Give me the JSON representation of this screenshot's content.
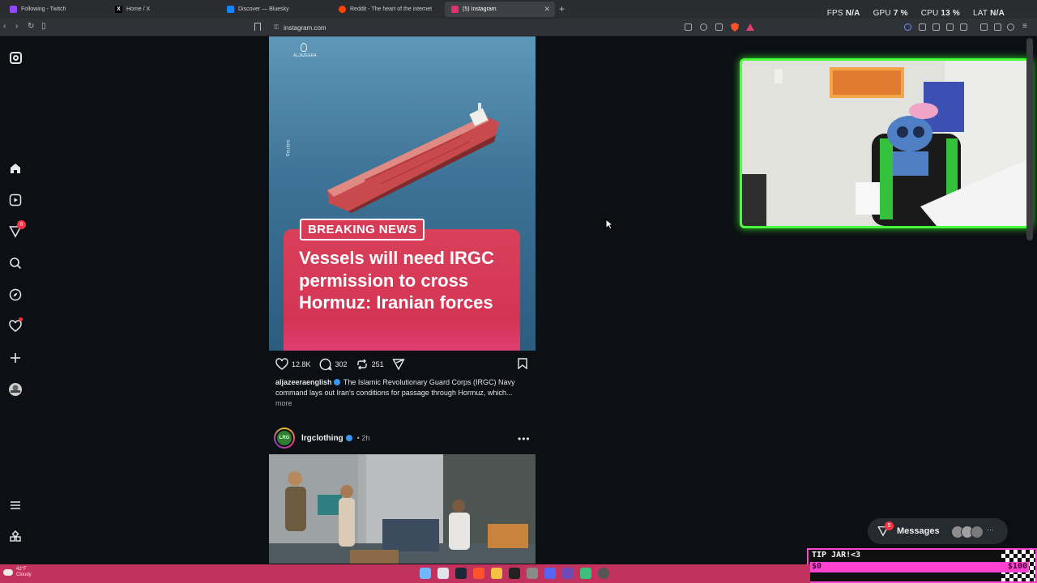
{
  "browser": {
    "tabs": [
      {
        "label": "Following - Twitch",
        "icon": "twitch-icon",
        "color": "#9146ff"
      },
      {
        "label": "Home / X",
        "icon": "x-icon",
        "color": "#000000"
      },
      {
        "label": "Discover — Bluesky",
        "icon": "bluesky-icon",
        "color": "#1185fe"
      },
      {
        "label": "Reddit - The heart of the internet",
        "icon": "reddit-icon",
        "color": "#ff4500"
      },
      {
        "label": "(5) Instagram",
        "icon": "instagram-icon",
        "color": "#e1306c",
        "active": true
      }
    ],
    "url": "instagram.com"
  },
  "perf": {
    "fps_label": "FPS",
    "fps_value": "N/A",
    "gpu_label": "GPU",
    "gpu_value": "7 %",
    "cpu_label": "CPU",
    "cpu_value": "13 %",
    "lat_label": "LAT",
    "lat_value": "N/A"
  },
  "sidebar": {
    "items": [
      {
        "name": "instagram-logo-icon"
      },
      {
        "name": "home-icon"
      },
      {
        "name": "reels-icon"
      },
      {
        "name": "direct-messages-icon",
        "badge": "6"
      },
      {
        "name": "search-icon"
      },
      {
        "name": "explore-icon"
      },
      {
        "name": "notifications-icon"
      },
      {
        "name": "create-icon"
      },
      {
        "name": "profile-icon"
      },
      {
        "name": "more-menu-icon"
      },
      {
        "name": "also-from-meta-icon"
      }
    ]
  },
  "post1": {
    "media_logo": "ALJAZEERA",
    "media_credit": "Reuters",
    "badge": "BREAKING NEWS",
    "headline": "Vessels will need IRGC permission to cross Hormuz: Iranian forces",
    "likes": "12.8K",
    "comments": "302",
    "reposts": "251",
    "caption_user": "aljazeeraenglish",
    "caption_text": "The Islamic Revolutionary Guard Corps (IRGC) Navy command lays out Iran's conditions for passage through Hormuz, which...",
    "caption_more": "more"
  },
  "post2": {
    "user": "lrgclothing",
    "time": "• 2h",
    "avatar_text": "LRG"
  },
  "messages": {
    "label": "Messages",
    "badge": "5"
  },
  "tipjar": {
    "title": "TIP JAR!<3",
    "min": "$0",
    "max": "$100",
    "progress": 0
  },
  "weather": {
    "temp": "42°F",
    "condition": "Cloudy"
  },
  "colors": {
    "accent_green": "#47ff3a",
    "tip_pink": "#ff43d0",
    "taskbar": "#c2325f",
    "breaking_red": "#d63a55"
  }
}
